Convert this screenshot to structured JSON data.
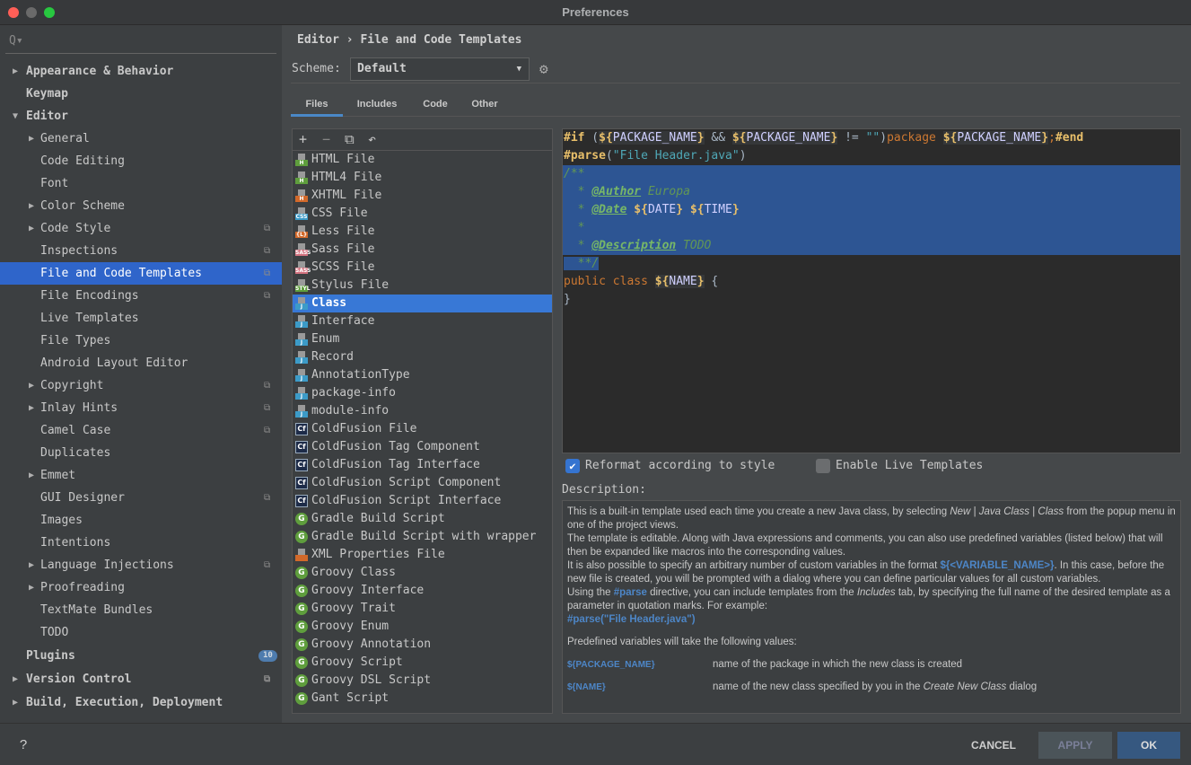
{
  "window": {
    "title": "Preferences"
  },
  "sidebar": {
    "search_placeholder": "Q▾",
    "items": [
      {
        "label": "Appearance & Behavior",
        "level": 0,
        "arrow": "right",
        "bold": true
      },
      {
        "label": "Keymap",
        "level": 0,
        "bold": true
      },
      {
        "label": "Editor",
        "level": 0,
        "arrow": "down",
        "bold": true
      },
      {
        "label": "General",
        "level": 1,
        "arrow": "right"
      },
      {
        "label": "Code Editing",
        "level": 1
      },
      {
        "label": "Font",
        "level": 1
      },
      {
        "label": "Color Scheme",
        "level": 1,
        "arrow": "right"
      },
      {
        "label": "Code Style",
        "level": 1,
        "arrow": "right",
        "copy": true
      },
      {
        "label": "Inspections",
        "level": 1,
        "copy": true
      },
      {
        "label": "File and Code Templates",
        "level": 1,
        "copy": true,
        "selected": true
      },
      {
        "label": "File Encodings",
        "level": 1,
        "copy": true
      },
      {
        "label": "Live Templates",
        "level": 1
      },
      {
        "label": "File Types",
        "level": 1
      },
      {
        "label": "Android Layout Editor",
        "level": 1
      },
      {
        "label": "Copyright",
        "level": 1,
        "arrow": "right",
        "copy": true
      },
      {
        "label": "Inlay Hints",
        "level": 1,
        "arrow": "right",
        "copy": true
      },
      {
        "label": "Camel Case",
        "level": 1,
        "copy": true
      },
      {
        "label": "Duplicates",
        "level": 1
      },
      {
        "label": "Emmet",
        "level": 1,
        "arrow": "right"
      },
      {
        "label": "GUI Designer",
        "level": 1,
        "copy": true
      },
      {
        "label": "Images",
        "level": 1
      },
      {
        "label": "Intentions",
        "level": 1
      },
      {
        "label": "Language Injections",
        "level": 1,
        "arrow": "right",
        "copy": true
      },
      {
        "label": "Proofreading",
        "level": 1,
        "arrow": "right"
      },
      {
        "label": "TextMate Bundles",
        "level": 1
      },
      {
        "label": "TODO",
        "level": 1
      },
      {
        "label": "Plugins",
        "level": 0,
        "bold": true,
        "badge": "10"
      },
      {
        "label": "Version Control",
        "level": 0,
        "arrow": "right",
        "bold": true,
        "copy": true
      },
      {
        "label": "Build, Execution, Deployment",
        "level": 0,
        "arrow": "right",
        "bold": true
      }
    ]
  },
  "breadcrumb": {
    "parent": "Editor",
    "sep": "›",
    "current": "File and Code Templates"
  },
  "scheme": {
    "label": "Scheme:",
    "value": "Default"
  },
  "tabs": [
    {
      "label": "Files",
      "active": true
    },
    {
      "label": "Includes"
    },
    {
      "label": "Code"
    },
    {
      "label": "Other"
    }
  ],
  "toolbar": {
    "add": "+",
    "remove": "−",
    "copy": "⧉",
    "reset": "↶"
  },
  "files": [
    {
      "label": "HTML File",
      "icon": "html",
      "badge": "H",
      "color": "#5f9e3d"
    },
    {
      "label": "HTML4 File",
      "icon": "html",
      "badge": "H",
      "color": "#5f9e3d"
    },
    {
      "label": "XHTML File",
      "icon": "html",
      "badge": "H",
      "color": "#d2692a"
    },
    {
      "label": "CSS File",
      "icon": "css",
      "badge": "CSS",
      "color": "#3c9bc8"
    },
    {
      "label": "Less File",
      "icon": "less",
      "badge": "{L}",
      "color": "#d2692a"
    },
    {
      "label": "Sass File",
      "icon": "sass",
      "badge": "SASS",
      "color": "#d3727f"
    },
    {
      "label": "SCSS File",
      "icon": "sass",
      "badge": "SASS",
      "color": "#d3727f"
    },
    {
      "label": "Stylus File",
      "icon": "stylus",
      "badge": "STYL",
      "color": "#5f9e3d"
    },
    {
      "label": "Class",
      "icon": "java",
      "badge": "J",
      "color": "#3c9bc8",
      "selected": true
    },
    {
      "label": "Interface",
      "icon": "java",
      "badge": "J",
      "color": "#3c9bc8"
    },
    {
      "label": "Enum",
      "icon": "java",
      "badge": "J",
      "color": "#3c9bc8"
    },
    {
      "label": "Record",
      "icon": "java",
      "badge": "J",
      "color": "#3c9bc8"
    },
    {
      "label": "AnnotationType",
      "icon": "java",
      "badge": "J",
      "color": "#3c9bc8"
    },
    {
      "label": "package-info",
      "icon": "java",
      "badge": "J",
      "color": "#3c9bc8"
    },
    {
      "label": "module-info",
      "icon": "java",
      "badge": "J",
      "color": "#3c9bc8"
    },
    {
      "label": "ColdFusion File",
      "icon": "coldfusion",
      "badge": "Cf",
      "color": "#1d2b48"
    },
    {
      "label": "ColdFusion Tag Component",
      "icon": "coldfusion",
      "badge": "Cf",
      "color": "#1d2b48"
    },
    {
      "label": "ColdFusion Tag Interface",
      "icon": "coldfusion",
      "badge": "Cf",
      "color": "#1d2b48"
    },
    {
      "label": "ColdFusion Script Component",
      "icon": "coldfusion",
      "badge": "Cf",
      "color": "#1d2b48"
    },
    {
      "label": "ColdFusion Script Interface",
      "icon": "coldfusion",
      "badge": "Cf",
      "color": "#1d2b48"
    },
    {
      "label": "Gradle Build Script",
      "icon": "gradle",
      "badge": "G",
      "color": "#5f9e3d"
    },
    {
      "label": "Gradle Build Script with wrapper",
      "icon": "gradle",
      "badge": "G",
      "color": "#5f9e3d"
    },
    {
      "label": "XML Properties File",
      "icon": "xml",
      "badge": "</>",
      "color": "#d2692a"
    },
    {
      "label": "Groovy Class",
      "icon": "groovy",
      "badge": "G",
      "color": "#5f9e3d"
    },
    {
      "label": "Groovy Interface",
      "icon": "groovy",
      "badge": "G",
      "color": "#5f9e3d"
    },
    {
      "label": "Groovy Trait",
      "icon": "groovy",
      "badge": "G",
      "color": "#5f9e3d"
    },
    {
      "label": "Groovy Enum",
      "icon": "groovy",
      "badge": "G",
      "color": "#5f9e3d"
    },
    {
      "label": "Groovy Annotation",
      "icon": "groovy",
      "badge": "G",
      "color": "#5f9e3d"
    },
    {
      "label": "Groovy Script",
      "icon": "groovy",
      "badge": "G",
      "color": "#5f9e3d"
    },
    {
      "label": "Groovy DSL Script",
      "icon": "groovy",
      "badge": "G",
      "color": "#5f9e3d"
    },
    {
      "label": "Gant Script",
      "icon": "groovy",
      "badge": "G",
      "color": "#5f9e3d"
    }
  ],
  "editor": {
    "lines": [
      {
        "tokens": [
          [
            "dir",
            "#if"
          ],
          [
            "op",
            " ("
          ],
          [
            "br",
            "${"
          ],
          [
            "var",
            "PACKAGE_NAME"
          ],
          [
            "br",
            "}"
          ],
          [
            "op",
            " && "
          ],
          [
            "br",
            "${"
          ],
          [
            "var",
            "PACKAGE_NAME"
          ],
          [
            "br",
            "}"
          ],
          [
            "op",
            " != "
          ],
          [
            "str",
            "\"\""
          ],
          [
            "op",
            ")"
          ],
          [
            "kw",
            "package "
          ],
          [
            "br",
            "${"
          ],
          [
            "var",
            "PACKAGE_NAME"
          ],
          [
            "br",
            "}"
          ],
          [
            "kw",
            ";"
          ],
          [
            "dir",
            "#end"
          ]
        ]
      },
      {
        "tokens": [
          [
            "dir",
            "#parse"
          ],
          [
            "op",
            "("
          ],
          [
            "str",
            "\"File Header.java\""
          ],
          [
            "op",
            ")"
          ]
        ]
      },
      {
        "hl": true,
        "tokens": [
          [
            "cm",
            "/**"
          ]
        ]
      },
      {
        "hl": true,
        "tokens": [
          [
            "cm",
            "  * "
          ],
          [
            "tag",
            "@Author"
          ],
          [
            "cm",
            " Europa"
          ]
        ]
      },
      {
        "hl": true,
        "tokens": [
          [
            "cm",
            "  * "
          ],
          [
            "tag",
            "@Date"
          ],
          [
            "txt",
            " "
          ],
          [
            "br",
            "${"
          ],
          [
            "var",
            "DATE"
          ],
          [
            "br",
            "}"
          ],
          [
            "txt",
            " "
          ],
          [
            "br",
            "${"
          ],
          [
            "var",
            "TIME"
          ],
          [
            "br",
            "}"
          ]
        ]
      },
      {
        "hl": true,
        "tokens": [
          [
            "cm",
            "  *"
          ]
        ]
      },
      {
        "hl": true,
        "tokens": [
          [
            "cm",
            "  * "
          ],
          [
            "tag",
            "@Description"
          ],
          [
            "cm",
            " TODO"
          ]
        ]
      },
      {
        "hl": "partial",
        "tokens": [
          [
            "cm",
            "  **/"
          ]
        ]
      },
      {
        "tokens": [
          [
            "kw",
            "public class "
          ],
          [
            "br",
            "${"
          ],
          [
            "var",
            "NAME"
          ],
          [
            "br",
            "}"
          ],
          [
            "txt",
            " {"
          ]
        ]
      },
      {
        "tokens": [
          [
            "txt",
            "}"
          ]
        ]
      }
    ]
  },
  "options": {
    "reformat": {
      "label": "Reformat according to style",
      "checked": true
    },
    "live_templates": {
      "label": "Enable Live Templates",
      "checked": false
    }
  },
  "description": {
    "label": "Description:",
    "p1a": "This is a built-in template used each time you create a new Java class, by selecting ",
    "p1_new": "New",
    "p1_sep1": " | ",
    "p1_jc": "Java Class",
    "p1_sep2": " | ",
    "p1_cls": "Class",
    "p1b": " from the popup menu in one of the project views.",
    "p2": "The template is editable. Along with Java expressions and comments, you can also use predefined variables (listed below) that will then be expanded like macros into the corresponding values.",
    "p3a": "It is also possible to specify an arbitrary number of custom variables in the format ",
    "p3_var": "${<VARIABLE_NAME>}",
    "p3b": ". In this case, before the new file is created, you will be prompted with a dialog where you can define particular values for all custom variables.",
    "p4a": "Using the ",
    "p4_parse": "#parse",
    "p4b": " directive, you can include templates from the ",
    "p4_inc": "Includes",
    "p4c": " tab, by specifying the full name of the desired template as a parameter in quotation marks. For example:",
    "p4_example": "#parse(\"File Header.java\")",
    "p5": "Predefined variables will take the following values:",
    "vars": [
      {
        "name": "${PACKAGE_NAME}",
        "desc": "name of the package in which the new class is created"
      },
      {
        "name": "${NAME}",
        "desc_a": "name of the new class specified by you in the ",
        "desc_i": "Create New Class",
        "desc_b": " dialog"
      }
    ]
  },
  "buttons": {
    "help": "?",
    "cancel": "CANCEL",
    "apply": "APPLY",
    "ok": "OK"
  },
  "colors": {
    "accent": "#2f65ca",
    "ok": "#365880",
    "selection": "#2d5593"
  }
}
